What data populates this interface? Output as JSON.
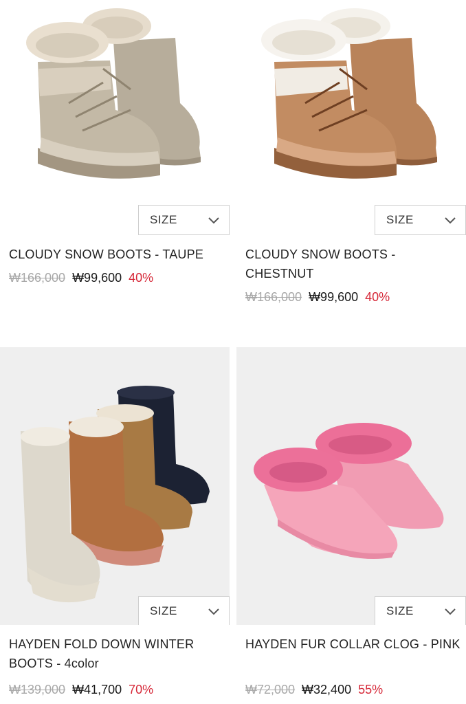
{
  "size_label": "SIZE",
  "products": [
    {
      "name": "CLOUDY SNOW BOOTS - TAUPE",
      "original_price": "₩166,000",
      "sale_price": "₩99,600",
      "discount": "40%"
    },
    {
      "name": "CLOUDY SNOW BOOTS - CHESTNUT",
      "original_price": "₩166,000",
      "sale_price": "₩99,600",
      "discount": "40%"
    },
    {
      "name": "HAYDEN FOLD DOWN WINTER BOOTS - 4color",
      "original_price": "₩139,000",
      "sale_price": "₩41,700",
      "discount": "70%"
    },
    {
      "name": "HAYDEN FUR COLLAR CLOG - PINK",
      "original_price": "₩72,000",
      "sale_price": "₩32,400",
      "discount": "55%"
    }
  ],
  "colors": {
    "discount": "#d62838",
    "original_price": "#a8a8a8",
    "image_bg": "#efefef"
  }
}
